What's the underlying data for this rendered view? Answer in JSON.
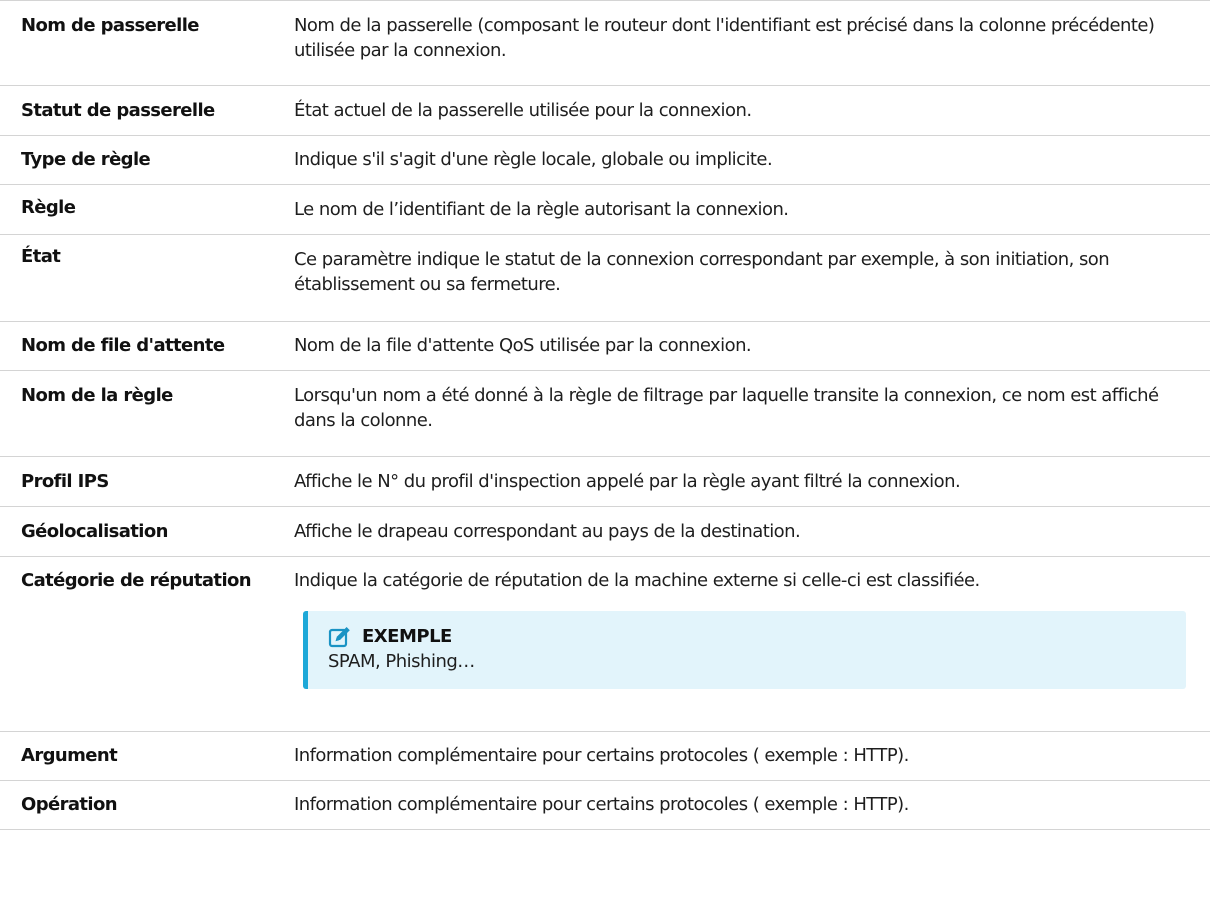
{
  "rows": [
    {
      "name": "Nom de passerelle",
      "desc": "Nom de la passerelle (composant le routeur dont l'identifiant est précisé dans la colonne précédente) utilisée par la connexion."
    },
    {
      "name": "Statut de passerelle",
      "desc": "État actuel de la passerelle utilisée pour la connexion."
    },
    {
      "name": "Type de règle",
      "desc": "Indique s'il s'agit d'une règle locale, globale ou implicite."
    },
    {
      "name": "Règle",
      "desc": "Le nom de l’identifiant de la règle autorisant la connexion."
    },
    {
      "name": "État",
      "desc": "Ce paramètre indique le statut de la connexion correspondant par exemple, à son initiation, son établissement ou sa fermeture."
    },
    {
      "name": "Nom de file d'attente",
      "desc": "Nom de la file d'attente QoS utilisée par la connexion."
    },
    {
      "name": "Nom de la règle",
      "desc": "Lorsqu'un nom a été donné à la règle de filtrage par laquelle transite la connexion, ce nom est affiché dans la colonne."
    },
    {
      "name": "Profil IPS",
      "desc": "Affiche le N° du profil d'inspection appelé par la règle ayant filtré la connexion."
    },
    {
      "name": "Géolocalisation",
      "desc": "Affiche le drapeau correspondant au pays de la destination."
    },
    {
      "name": "Catégorie de réputation",
      "desc": "Indique la catégorie de réputation de la machine externe si celle-ci est classifiée.",
      "note": {
        "icon": "edit-note-icon",
        "title": "EXEMPLE",
        "text": "SPAM, Phishing…"
      }
    },
    {
      "name": "Argument",
      "desc": "Information complémentaire pour certains protocoles ( exemple : HTTP)."
    },
    {
      "name": "Opération",
      "desc": "Information complémentaire pour certains protocoles ( exemple : HTTP)."
    }
  ],
  "colors": {
    "note_background": "#e2f4fb",
    "note_accent": "#1da8d8",
    "row_divider": "#d4d4d4"
  }
}
